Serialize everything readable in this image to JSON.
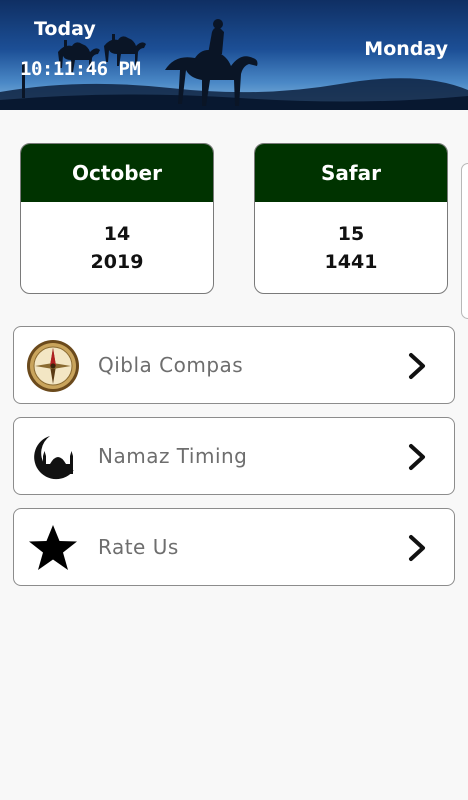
{
  "header": {
    "today_label": "Today",
    "time": "10:11:46 PM",
    "day": "Monday"
  },
  "gregorian": {
    "month": "October",
    "day": "14",
    "year": "2019"
  },
  "hijri": {
    "month": "Safar",
    "day": "15",
    "year": "1441"
  },
  "menu": [
    {
      "label": "Qibla Compas",
      "icon": "compass-icon"
    },
    {
      "label": "Namaz Timing",
      "icon": "mosque-crescent-icon"
    },
    {
      "label": "Rate Us",
      "icon": "star-icon"
    }
  ],
  "colors": {
    "card_header": "#003300",
    "header_sky_top": "#0f2f63",
    "header_sky_bottom": "#8fbde0"
  }
}
